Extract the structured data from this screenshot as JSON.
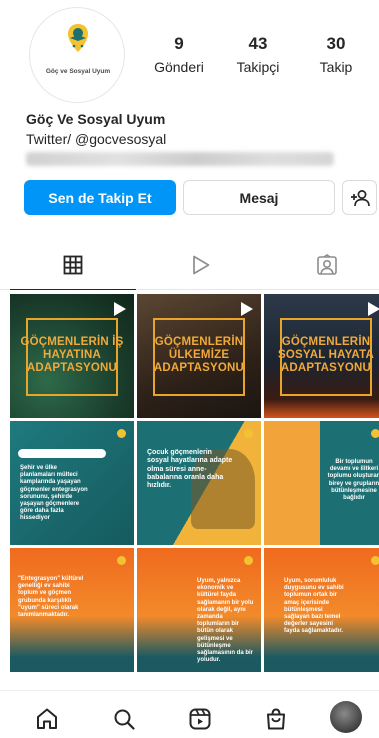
{
  "profile": {
    "logo_text": "Göç ve Sosyal Uyum",
    "display_name": "Göç Ve Sosyal Uyum",
    "handle_line": "Twitter/ @gocvesosyal"
  },
  "stats": [
    {
      "value": "9",
      "label": "Gönderi"
    },
    {
      "value": "43",
      "label": "Takipçi"
    },
    {
      "value": "30",
      "label": "Takip"
    }
  ],
  "actions": {
    "follow_label": "Sen de Takip Et",
    "message_label": "Mesaj"
  },
  "tabs": [
    "grid-icon",
    "reels-play-icon",
    "tagged-person-icon"
  ],
  "posts": [
    {
      "title": "GÖÇMENLERİN İŞ HAYATINA ADAPTASYONU"
    },
    {
      "title": "GÖÇMENLERİN ÜLKEMİZE ADAPTASYONU"
    },
    {
      "title": "GÖÇMENLERİN SOSYAL HAYATA ADAPTASYONU"
    },
    {
      "text": "Şehir ve ülke planlamaları mülteci kamplarında yaşayan göçmenler entegrasyon sorununu, şehirde yaşayan göçmenlere göre daha fazla hissediyor"
    },
    {
      "text": "Çocuk göçmenlerin sosyal hayatlarına adapte olma süresi anne-babalarına oranla daha hızlıdır."
    },
    {
      "text": "Bir toplumun devamı ve ilitkeri toplumu oluşturan birey ve grupların bütünleşmesine bağlıdır"
    },
    {
      "text": "\"Entegrasyon\" kültürel genelliği ev sahibi toplum ve göçmen grubunda karşılıklı \"uyum\" süreci olarak tanımlanmaktadır."
    },
    {
      "text": "Uyum, yalnızca ekonomik ve kültürel fayda sağlamanın bir yolu olarak değil, aynı zamanda toplumların bir bütün olarak gelişmesi ve bütünleşme sağlamasının da bir yoludur."
    },
    {
      "text": "Uyum, sorumluluk duygusunu ev sahibi toplumun ortak bir amaç içerisinde bütünleşmesi sağlayan bazı temel değerler sayesini fayda sağlamaktadır."
    }
  ],
  "bottom_nav": [
    "home-icon",
    "search-icon",
    "reels-icon",
    "shop-icon",
    "profile-avatar"
  ],
  "colors": {
    "follow_blue": "#0095f6",
    "tile_teal": "#1c6f73",
    "tile_orange": "#f4a13a",
    "tile_yellow": "#f2c230"
  }
}
